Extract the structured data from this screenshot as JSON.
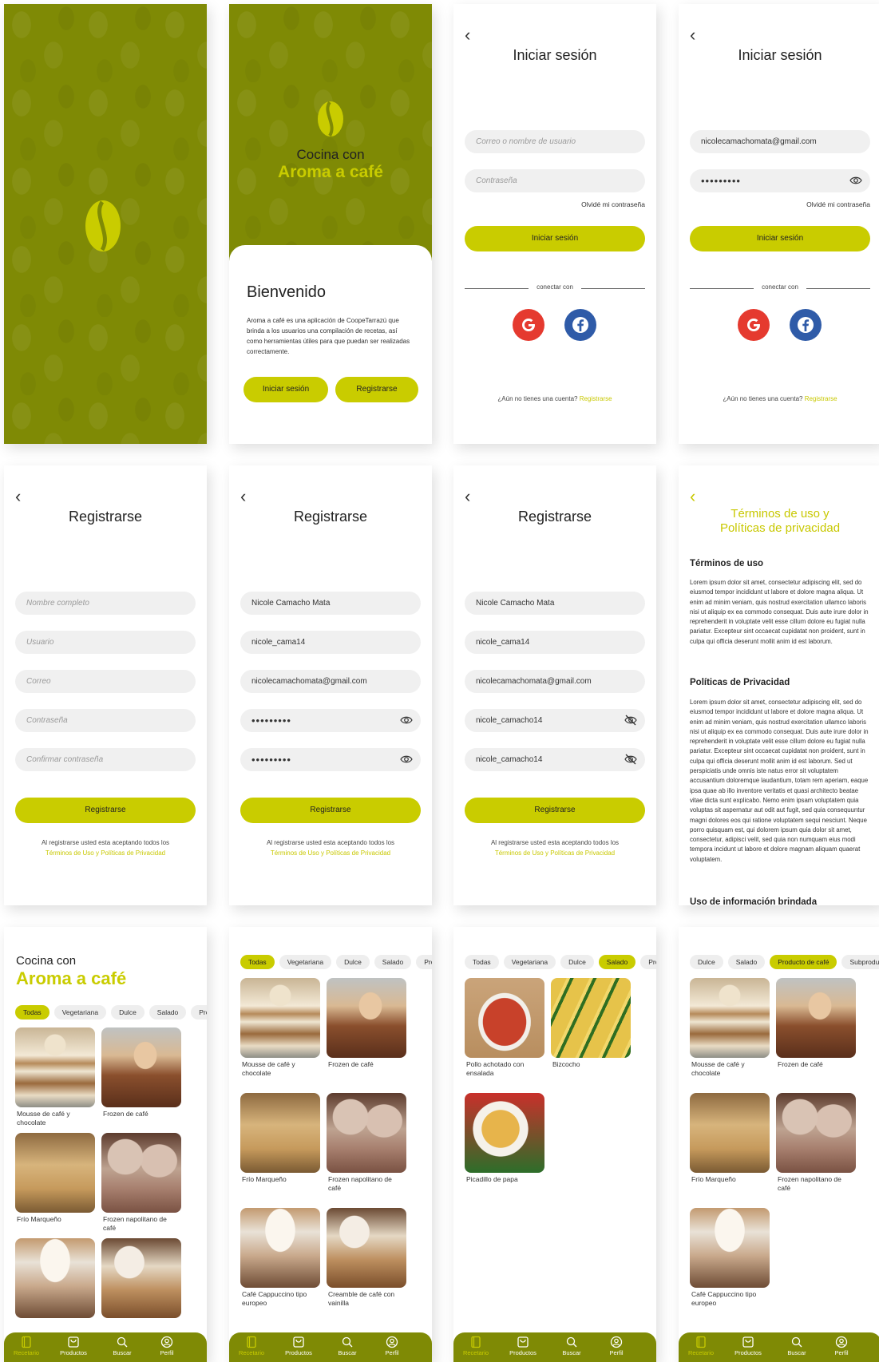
{
  "colors": {
    "olive": "#7f8a05",
    "accent": "#c9cc00",
    "field_bg": "#f0f0f0",
    "google": "#e53a2f",
    "facebook": "#2f5ba8"
  },
  "welcome": {
    "line1": "Cocina con",
    "line2": "Aroma a café",
    "heading": "Bienvenido",
    "body": "Aroma a café es una aplicación de CoopeTarrazú que brinda a los usuarios una compilación de recetas, así como herramientas útiles para que puedan ser realizadas correctamente.",
    "login_button": "Iniciar sesión",
    "register_button": "Registrarse"
  },
  "login": {
    "title": "Iniciar sesión",
    "user_placeholder": "Correo o nombre de usuario",
    "password_placeholder": "Contraseña",
    "user_value": "nicolecamachomata@gmail.com",
    "password_value": "•••••••••",
    "forgot": "Olvidé mi contraseña",
    "submit": "Iniciar sesión",
    "connect_with": "conectar con",
    "no_account": "¿Aún no tienes una cuenta?",
    "register_link": "Registrarse",
    "icons": [
      "google-icon",
      "facebook-icon",
      "eye-icon",
      "back-chevron-icon"
    ]
  },
  "register": {
    "title": "Registrarse",
    "placeholders": {
      "name": "Nombre completo",
      "user": "Usuario",
      "email": "Correo",
      "password": "Contraseña",
      "confirm": "Confirmar contraseña"
    },
    "values": {
      "name": "Nicole Camacho Mata",
      "user": "nicole_cama14",
      "email": "nicolecamachomata@gmail.com",
      "password_hidden": "•••••••••",
      "password_visible": "nicole_camacho14"
    },
    "submit": "Registrarse",
    "note": "Al registrarse usted esta aceptando todos los",
    "note_link": "Términos de Uso y Políticas de Privacidad"
  },
  "terms": {
    "title_line1": "Términos de uso y",
    "title_line2": "Políticas de privacidad",
    "section1_title": "Términos de uso",
    "section1_body": "Lorem ipsum dolor sit amet, consectetur adipiscing elit, sed do eiusmod tempor incididunt ut labore et dolore magna aliqua. Ut enim ad minim veniam, quis nostrud exercitation ullamco laboris nisi ut aliquip ex ea commodo consequat. Duis aute irure dolor in reprehenderit in voluptate velit esse cillum dolore eu fugiat nulla pariatur. Excepteur sint occaecat cupidatat non proident, sunt in culpa qui officia deserunt mollit anim id est laborum.",
    "section2_title": "Políticas de Privacidad",
    "section2_body": "Lorem ipsum dolor sit amet, consectetur adipiscing elit, sed do eiusmod tempor incididunt ut labore et dolore magna aliqua. Ut enim ad minim veniam, quis nostrud exercitation ullamco laboris nisi ut aliquip ex ea commodo consequat. Duis aute irure dolor in reprehenderit in voluptate velit esse cillum dolore eu fugiat nulla pariatur. Excepteur sint occaecat cupidatat non proident, sunt in culpa qui officia deserunt mollit anim id est laborum. Sed ut perspiciatis unde omnis iste natus error sit voluptatem accusantium doloremque laudantium, totam rem aperiam, eaque ipsa quae ab illo inventore veritatis et quasi architecto beatae vitae dicta sunt explicabo. Nemo enim ipsam voluptatem quia voluptas sit aspernatur aut odit aut fugit, sed quia consequuntur magni dolores eos qui ratione voluptatem sequi nesciunt. Neque porro quisquam est, qui dolorem ipsum quia dolor sit amet, consectetur, adipisci velit, sed quia non numquam eius modi tempora incidunt ut labore et dolore magnam aliquam quaerat voluptatem.",
    "section3_title": "Uso de información brindada"
  },
  "home": {
    "line1": "Cocina con",
    "line2": "Aroma a café"
  },
  "categories": [
    "Todas",
    "Vegetariana",
    "Dulce",
    "Salado",
    "Pro"
  ],
  "categories_b": [
    "Dulce",
    "Salado",
    "Producto de café",
    "Subproducto"
  ],
  "recipes": {
    "mousse": "Mousse de café y chocolate",
    "frozen": "Frozen de café",
    "marqueno": "Frío Marqueño",
    "napolitano": "Frozen napolitano de café",
    "cappuccino": "Café Cappuccino tipo europeo",
    "creamble": "Creamble de café con vainilla",
    "pollo": "Pollo achotado con ensalada",
    "bizcocho": "Bizcocho",
    "picadillo": "Picadillo de papa"
  },
  "nav": [
    "Recetario",
    "Productos",
    "Buscar",
    "Perfil"
  ]
}
